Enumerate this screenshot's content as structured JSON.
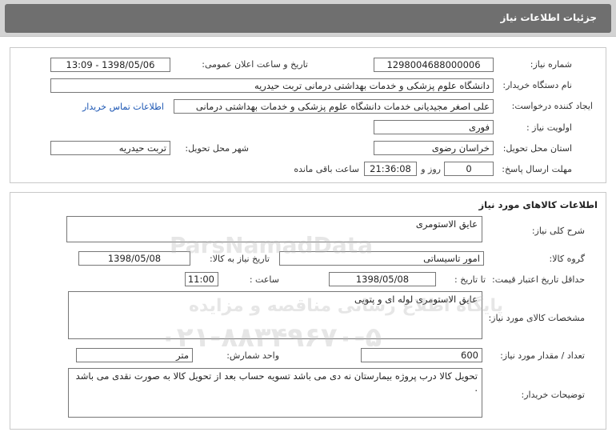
{
  "header": {
    "title": "جزئیات اطلاعات نیاز"
  },
  "need_info": {
    "need_number_label": "شماره نیاز:",
    "need_number": "1298004688000006",
    "announce_label": "تاریخ و ساعت اعلان عمومی:",
    "announce_value": "1398/05/06 - 13:09",
    "buyer_org_label": "نام دستگاه خریدار:",
    "buyer_org": "دانشگاه علوم پزشکی و خدمات بهداشتی درمانی تربت حیدریه",
    "creator_label": "ایجاد کننده درخواست:",
    "creator": "علی اصغر مجیدیانی خدمات دانشگاه علوم پزشکی و خدمات بهداشتی درمانی",
    "contact_link": "اطلاعات تماس خریدار",
    "priority_label": "اولویت نیاز :",
    "priority": "فوری",
    "province_label": "استان محل تحویل:",
    "province": "خراسان رضوی",
    "city_label": "شهر محل تحویل:",
    "city": "تربت حیدریه",
    "deadline_label": "مهلت ارسال پاسخ:",
    "deadline_days": "0",
    "days_word": "روز و",
    "deadline_time": "21:36:08",
    "remaining_word": "ساعت باقی مانده"
  },
  "goods": {
    "section_title": "اطلاعات کالاهای مورد نیاز",
    "summary_label": "شرح کلی نیاز:",
    "summary": "عایق الاستومری",
    "group_label": "گروه کالا:",
    "group": "امور تاسیساتی",
    "need_date_label": "تاریخ نیاز به کالا:",
    "need_date": "1398/05/08",
    "min_validity_label": "حداقل تاریخ اعتبار قیمت:",
    "until_date_label": "تا تاریخ :",
    "until_date": "1398/05/08",
    "time_label": "ساعت :",
    "time": "11:00",
    "specs_label": "مشخصات کالای مورد نیاز:",
    "specs": "عایق الاستومری لوله ای و پتویی",
    "qty_label": "تعداد / مقدار مورد نیاز:",
    "qty": "600",
    "unit_label": "واحد شمارش:",
    "unit": "متر",
    "buyer_notes_label": "توضیحات خریدار:",
    "buyer_notes": "تحویل کالا درب پروژه بیمارستان نه دی می باشد تسویه حساب بعد از تحویل کالا به صورت نقدی می باشد ."
  },
  "watermark": {
    "brand": "ParsNamadData",
    "line1": "پایگاه اطلاع رسانی مناقصه و مزایده",
    "phone": "۰۲۱-۸۸۳۴۹۶۷۰-۵"
  }
}
